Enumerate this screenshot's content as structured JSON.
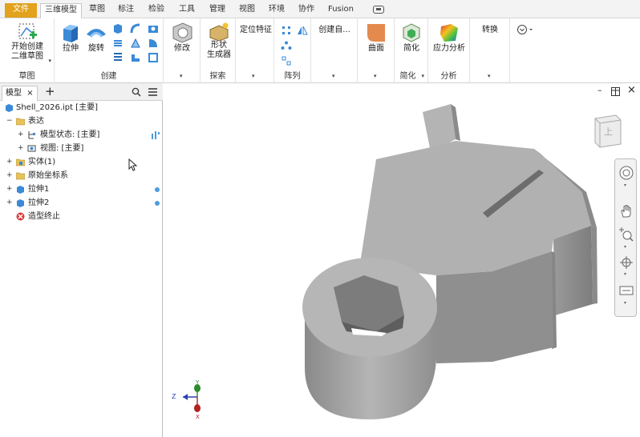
{
  "menu": {
    "file": "文件",
    "tabs": [
      "三维模型",
      "草图",
      "标注",
      "检验",
      "工具",
      "管理",
      "视图",
      "环境",
      "协作",
      "Fusion"
    ]
  },
  "ribbon": {
    "sketch": {
      "start_line1": "开始创建",
      "start_line2": "二维草图",
      "panel": "草图"
    },
    "create": {
      "extrude": "拉伸",
      "revolve": "旋转",
      "panel": "创建"
    },
    "modify": {
      "label": "修改"
    },
    "explore": {
      "shape_line1": "形状",
      "shape_line2": "生成器",
      "panel": "探索"
    },
    "work_features": {
      "label": "定位特征"
    },
    "pattern": {
      "panel": "阵列"
    },
    "create_freeform": {
      "label": "创建自..."
    },
    "surface": {
      "label": "曲面"
    },
    "simplify": {
      "label": "简化",
      "panel": "简化"
    },
    "analysis": {
      "label": "应力分析",
      "panel": "分析"
    },
    "convert": {
      "label": "转换"
    }
  },
  "browser": {
    "tab": "模型",
    "add": "+",
    "tree": [
      {
        "label": "Shell_2026.ipt [主要]"
      },
      {
        "label": "表达"
      },
      {
        "label": "模型状态: [主要]"
      },
      {
        "label": "视图: [主要]"
      },
      {
        "label": "实体(1)"
      },
      {
        "label": "原始坐标系"
      },
      {
        "label": "拉伸1"
      },
      {
        "label": "拉伸2"
      },
      {
        "label": "造型终止"
      }
    ]
  },
  "viewcube": {
    "face": "上"
  },
  "triad": {
    "y": "Y",
    "z": "Z",
    "x": "X"
  },
  "colors": {
    "file_tab": "#e2a21b",
    "accent_blue": "#4a9de0",
    "model_gray": "#b4b4b4"
  }
}
